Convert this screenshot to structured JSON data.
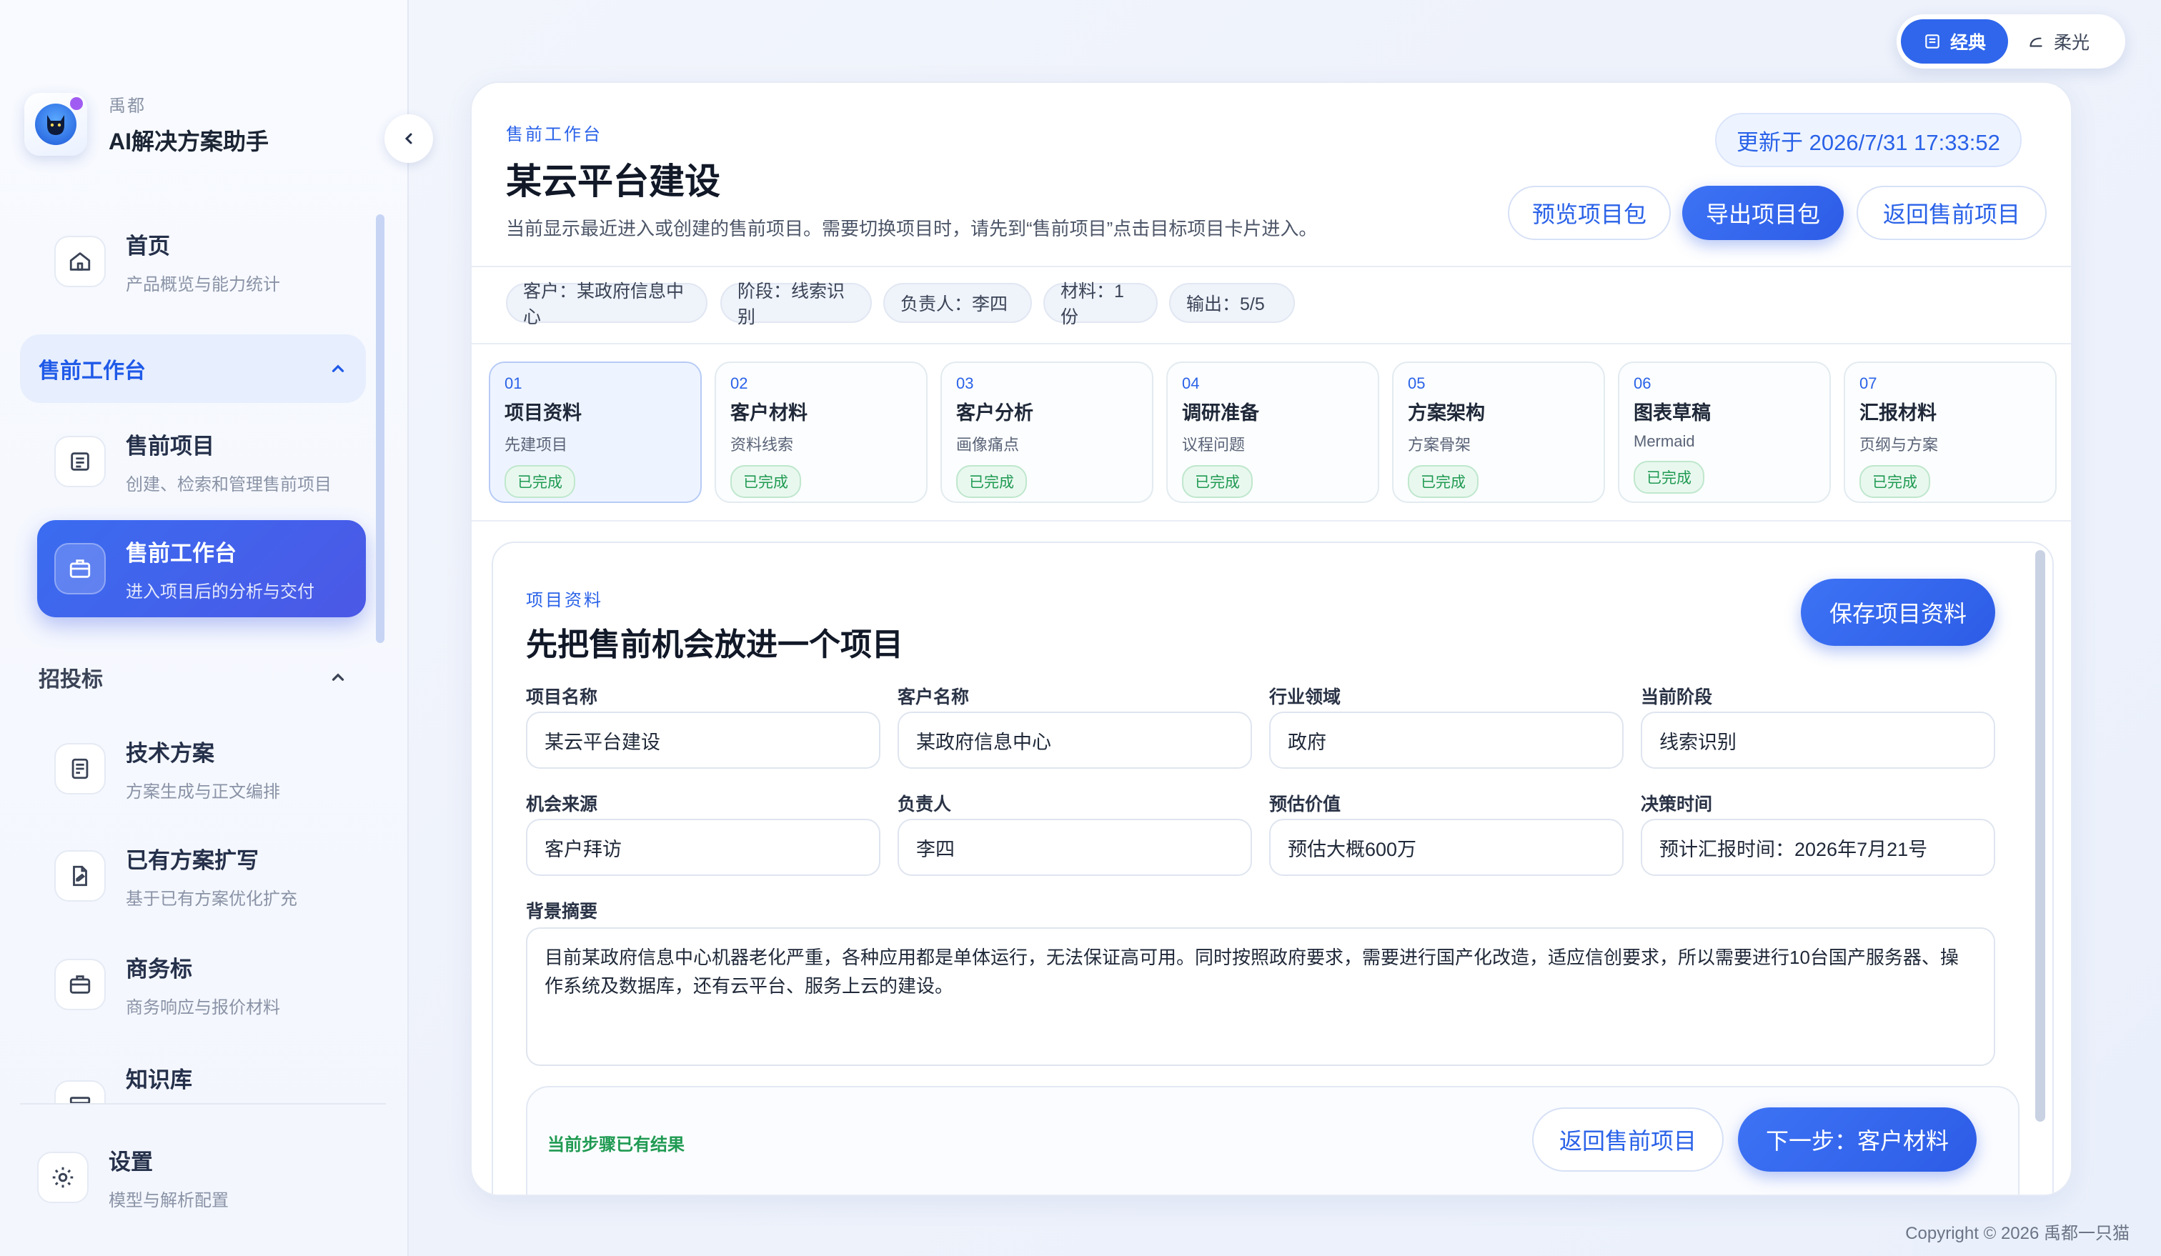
{
  "window": {
    "controls": [
      "close",
      "minimize",
      "zoom"
    ]
  },
  "brand": {
    "subtitle": "禹都",
    "title": "AI解决方案助手",
    "logo_icon": "cat-icon"
  },
  "sidebar": {
    "home": {
      "title": "首页",
      "desc": "产品概览与能力统计"
    },
    "section_presales": {
      "label": "售前工作台",
      "expanded": true
    },
    "presales_items": [
      {
        "title": "售前项目",
        "desc": "创建、检索和管理售前项目"
      },
      {
        "title": "售前工作台",
        "desc": "进入项目后的分析与交付",
        "active": true
      }
    ],
    "section_bidding": {
      "label": "招投标",
      "expanded": true
    },
    "bidding_items": [
      {
        "title": "技术方案",
        "desc": "方案生成与正文编排"
      },
      {
        "title": "已有方案扩写",
        "desc": "基于已有方案优化扩充"
      },
      {
        "title": "商务标",
        "desc": "商务响应与报价材料"
      },
      {
        "title": "知识库",
        "desc": ""
      }
    ],
    "settings": {
      "title": "设置",
      "desc": "模型与解析配置"
    }
  },
  "theme_toggle": {
    "options": [
      {
        "label": "经典",
        "selected": true
      },
      {
        "label": "柔光",
        "selected": false
      }
    ]
  },
  "header": {
    "eyebrow": "售前工作台",
    "title": "某云平台建设",
    "subtitle": "当前显示最近进入或创建的售前项目。需要切换项目时，请先到“售前项目”点击目标项目卡片进入。",
    "updated": "更新于 2026/7/31 17:33:52",
    "preview_btn": "预览项目包",
    "export_btn": "导出项目包",
    "back_btn": "返回售前项目"
  },
  "chips": [
    "客户：某政府信息中心",
    "阶段：线索识别",
    "负责人：李四",
    "材料：1 份",
    "输出：5/5"
  ],
  "steps": [
    {
      "num": "01",
      "title": "项目资料",
      "desc": "先建项目",
      "status": "已完成"
    },
    {
      "num": "02",
      "title": "客户材料",
      "desc": "资料线索",
      "status": "已完成"
    },
    {
      "num": "03",
      "title": "客户分析",
      "desc": "画像痛点",
      "status": "已完成"
    },
    {
      "num": "04",
      "title": "调研准备",
      "desc": "议程问题",
      "status": "已完成"
    },
    {
      "num": "05",
      "title": "方案架构",
      "desc": "方案骨架",
      "status": "已完成"
    },
    {
      "num": "06",
      "title": "图表草稿",
      "desc": "Mermaid",
      "status": "已完成"
    },
    {
      "num": "07",
      "title": "汇报材料",
      "desc": "页纲与方案",
      "status": "已完成"
    }
  ],
  "form": {
    "eyebrow": "项目资料",
    "title": "先把售前机会放进一个项目",
    "save_btn": "保存项目资料",
    "fields": [
      {
        "label": "项目名称",
        "value": "某云平台建设"
      },
      {
        "label": "客户名称",
        "value": "某政府信息中心"
      },
      {
        "label": "行业领域",
        "value": "政府"
      },
      {
        "label": "当前阶段",
        "value": "线索识别"
      },
      {
        "label": "机会来源",
        "value": "客户拜访"
      },
      {
        "label": "负责人",
        "value": "李四"
      },
      {
        "label": "预估价值",
        "value": "预估大概600万"
      },
      {
        "label": "决策时间",
        "value": "预计汇报时间：2026年7月21号"
      }
    ],
    "background": {
      "label": "背景摘要",
      "value": "目前某政府信息中心机器老化严重，各种应用都是单体运行，无法保证高可用。同时按照政府要求，需要进行国产化改造，适应信创要求，所以需要进行10台国产服务器、操作系统及数据库，还有云平台、服务上云的建设。"
    },
    "result": {
      "status": "当前步骤已有结果",
      "back_btn": "返回售前项目",
      "next_btn": "下一步：客户材料"
    }
  },
  "footer": {
    "copyright": "Copyright © 2026 禹都一只猫"
  },
  "colors": {
    "accent": "#2f66ec",
    "success": "#1f9a52",
    "background": "#f3f6fc"
  }
}
